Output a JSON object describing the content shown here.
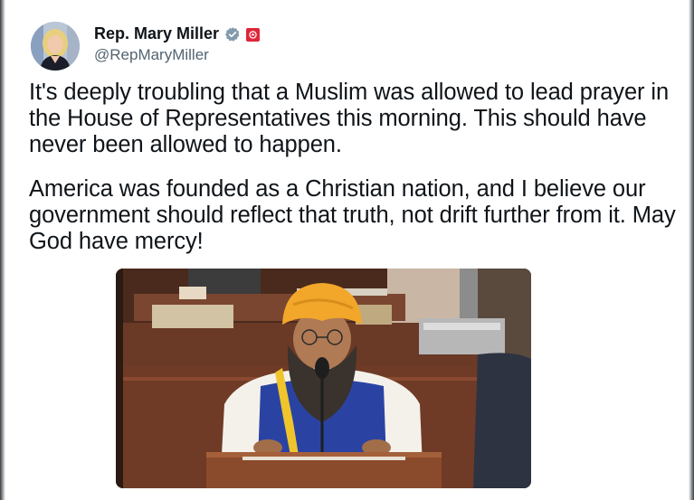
{
  "tweet": {
    "author": {
      "display_name": "Rep. Mary Miller",
      "handle": "@RepMaryMiller",
      "verified_badge_color": "#829aab",
      "gov_badge_color": "#e0263a",
      "icons": {
        "verified": "verified-badge-icon",
        "affiliation": "government-affiliation-icon"
      }
    },
    "paragraphs": [
      "It's deeply troubling that a Muslim was allowed to lead prayer in the House of Representatives this morning. This should have never been allowed to happen.",
      "America was founded as a Christian nation, and I believe our government should reflect that truth, not drift further from it. May God have mercy!"
    ]
  },
  "colors": {
    "text_primary": "#0f1419",
    "text_secondary": "#536471",
    "background": "#ffffff"
  }
}
